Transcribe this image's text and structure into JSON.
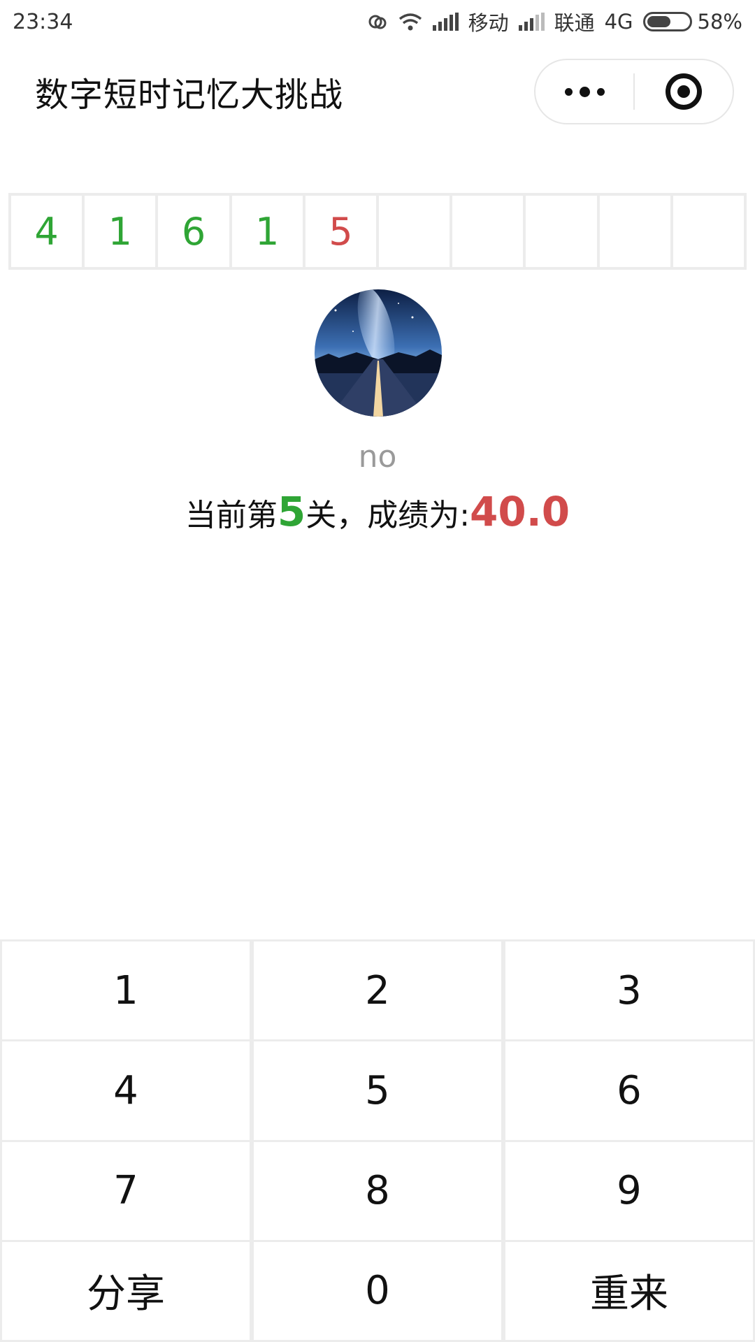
{
  "status_bar": {
    "time": "23:34",
    "carrier1": "移动",
    "carrier2": "联通",
    "network": "4G",
    "battery": "58%",
    "battery_level": 0.58,
    "icons": [
      "hd-icon",
      "wifi-icon",
      "signal-icon",
      "signal-icon",
      "battery-icon"
    ]
  },
  "header": {
    "title": "数字短时记忆大挑战",
    "more_icon": "more-dots-icon",
    "close_icon": "target-circle-icon"
  },
  "digits": [
    {
      "value": "4",
      "color": "#2fa535"
    },
    {
      "value": "1",
      "color": "#2fa535"
    },
    {
      "value": "6",
      "color": "#2fa535"
    },
    {
      "value": "1",
      "color": "#2fa535"
    },
    {
      "value": "5",
      "color": "#d14b4b"
    },
    {
      "value": "",
      "color": "#2fa535"
    },
    {
      "value": "",
      "color": "#2fa535"
    },
    {
      "value": "",
      "color": "#2fa535"
    },
    {
      "value": "",
      "color": "#2fa535"
    },
    {
      "value": "",
      "color": "#2fa535"
    }
  ],
  "user": {
    "name": "no",
    "avatar": "night-road-avatar"
  },
  "status": {
    "prefix": "当前第",
    "level": "5",
    "middle": "关，成绩为:",
    "score": "40.0"
  },
  "keypad": {
    "keys": [
      "1",
      "2",
      "3",
      "4",
      "5",
      "6",
      "7",
      "8",
      "9",
      "分享",
      "0",
      "重来"
    ]
  },
  "colors": {
    "accent_green": "#2fa535",
    "accent_red": "#d14b4b",
    "border": "#ececec"
  }
}
